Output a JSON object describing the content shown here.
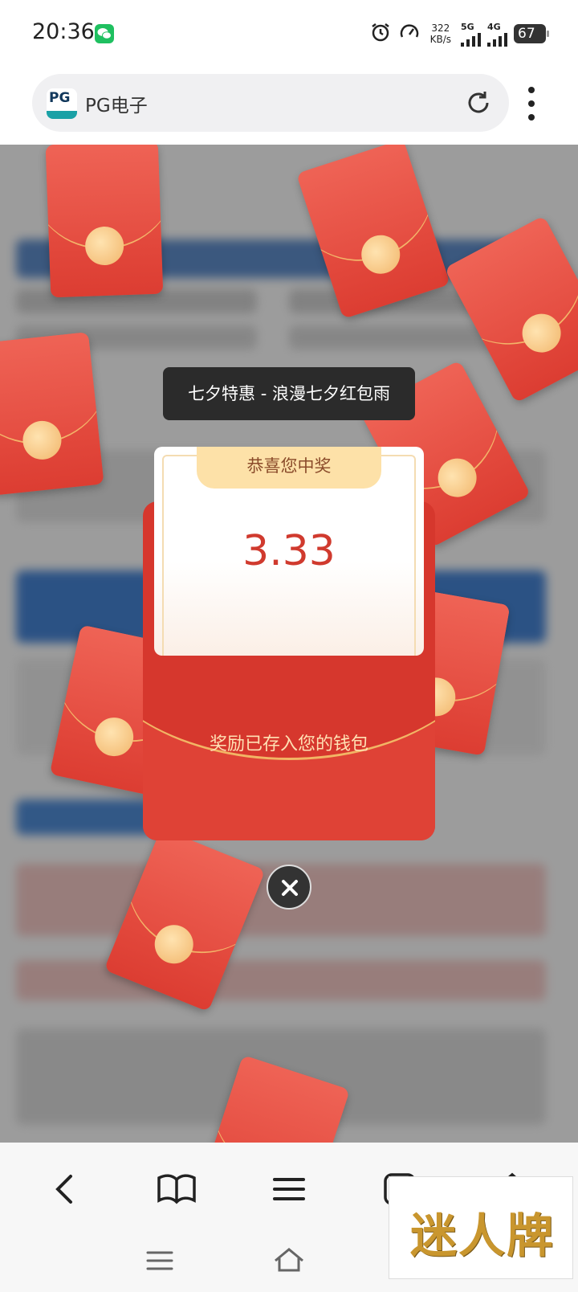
{
  "status_bar": {
    "time": "20:36",
    "net_speed_value": "322",
    "net_speed_unit": "KB/s",
    "sim1_type": "5G",
    "sim2_type": "4G",
    "battery": "67"
  },
  "browser": {
    "site_title": "PG电子",
    "site_logo_text": "PG"
  },
  "toast": {
    "text": "七夕特惠 - 浪漫七夕红包雨"
  },
  "prize": {
    "header": "恭喜您中奖",
    "amount": "3.33",
    "message": "奖励已存入您的钱包"
  },
  "watermark": {
    "text": "迷人牌"
  },
  "colors": {
    "envelope_red": "#df4236",
    "amount_red": "#d03a2e",
    "gold": "#f2b565"
  }
}
